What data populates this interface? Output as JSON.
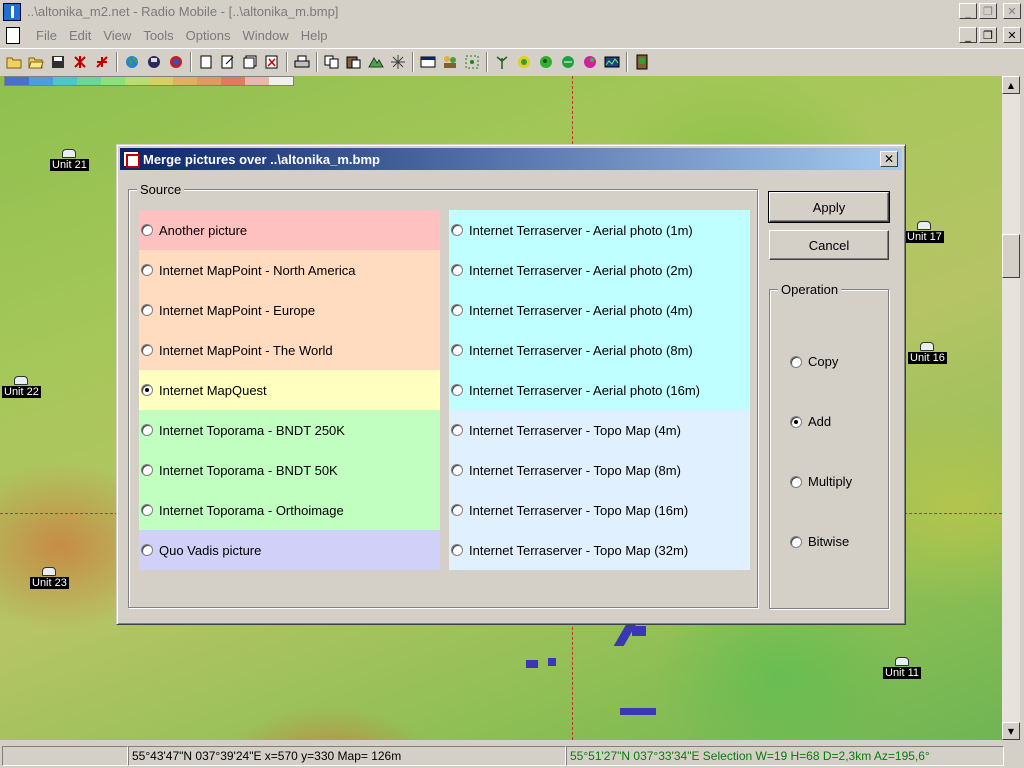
{
  "app": {
    "title": "..\\altonika_m2.net - Radio Mobile - [..\\altonika_m.bmp]",
    "window_buttons": [
      "_",
      "❐",
      "✕"
    ]
  },
  "menu": {
    "items": [
      "File",
      "Edit",
      "View",
      "Tools",
      "Options",
      "Window",
      "Help"
    ]
  },
  "toolbar": {
    "icons": [
      "new-folder-icon",
      "open-folder-icon",
      "save-icon",
      "network-icon",
      "units-icon",
      "globe-icon",
      "disk-icon",
      "target-icon",
      "page-icon",
      "edit-page-icon",
      "copy-page-icon",
      "pdf-icon",
      "print-icon",
      "copy-icon",
      "paste-icon",
      "map-3d-icon",
      "star-icon",
      "window-icon",
      "people-icon",
      "select-icon",
      "antenna-icon",
      "globe-yellow-icon",
      "globe-green-icon",
      "globe-green2-icon",
      "palette-icon",
      "spectrum-icon",
      "exit-icon"
    ]
  },
  "map": {
    "palette_colors": [
      "#4a6fd0",
      "#4a9de0",
      "#4ac8c8",
      "#6ad69a",
      "#8ee07a",
      "#b6e06a",
      "#d6d060",
      "#e0b060",
      "#e09a60",
      "#e07a60",
      "#e8b8b0",
      "#f0f0f0"
    ],
    "units": [
      {
        "name": "Unit 21"
      },
      {
        "name": "Unit 17"
      },
      {
        "name": "Unit 16"
      },
      {
        "name": "Unit 22"
      },
      {
        "name": "Unit 23"
      },
      {
        "name": "Unit 11"
      }
    ]
  },
  "status": {
    "left": "55°43'47\"N  037°39'24\"E  x=570 y=330 Map= 126m",
    "right": "55°51'27\"N 037°33'34\"E Selection W=19 H=68 D=2,3km Az=195,6°",
    "right_color": "#0a7a0a"
  },
  "dialog": {
    "title": "Merge pictures over ..\\altonika_m.bmp",
    "close": "✕",
    "source_label": "Source",
    "operation_label": "Operation",
    "apply": "Apply",
    "cancel": "Cancel",
    "sources_left": [
      {
        "label": "Another picture",
        "selected": false,
        "bg": "#ffc0c0"
      },
      {
        "label": "Internet MapPoint - North America",
        "selected": false,
        "bg": "#ffdcc0"
      },
      {
        "label": "Internet MapPoint - Europe",
        "selected": false,
        "bg": "#ffdcc0"
      },
      {
        "label": "Internet MapPoint - The World",
        "selected": false,
        "bg": "#ffdcc0"
      },
      {
        "label": "Internet MapQuest",
        "selected": true,
        "bg": "#ffffc0"
      },
      {
        "label": "Internet Toporama - BNDT 250K",
        "selected": false,
        "bg": "#c0ffc0"
      },
      {
        "label": "Internet Toporama - BNDT 50K",
        "selected": false,
        "bg": "#c0ffc0"
      },
      {
        "label": "Internet Toporama - Orthoimage",
        "selected": false,
        "bg": "#c0ffc0"
      },
      {
        "label": "Quo Vadis picture",
        "selected": false,
        "bg": "#d0d0f8"
      }
    ],
    "sources_right": [
      {
        "label": "Internet Terraserver - Aerial photo (1m)",
        "selected": false,
        "bg": "#c0ffff"
      },
      {
        "label": "Internet Terraserver - Aerial photo (2m)",
        "selected": false,
        "bg": "#c0ffff"
      },
      {
        "label": "Internet Terraserver - Aerial photo (4m)",
        "selected": false,
        "bg": "#c0ffff"
      },
      {
        "label": "Internet Terraserver - Aerial photo (8m)",
        "selected": false,
        "bg": "#c0ffff"
      },
      {
        "label": "Internet Terraserver - Aerial photo (16m)",
        "selected": false,
        "bg": "#c0ffff"
      },
      {
        "label": "Internet Terraserver - Topo Map (4m)",
        "selected": false,
        "bg": "#e0f0ff"
      },
      {
        "label": "Internet Terraserver - Topo Map (8m)",
        "selected": false,
        "bg": "#e0f0ff"
      },
      {
        "label": "Internet Terraserver - Topo Map (16m)",
        "selected": false,
        "bg": "#e0f0ff"
      },
      {
        "label": "Internet Terraserver - Topo Map (32m)",
        "selected": false,
        "bg": "#e0f0ff"
      }
    ],
    "operations": [
      {
        "label": "Copy",
        "selected": false
      },
      {
        "label": "Add",
        "selected": true
      },
      {
        "label": "Multiply",
        "selected": false
      },
      {
        "label": "Bitwise",
        "selected": false
      }
    ]
  }
}
